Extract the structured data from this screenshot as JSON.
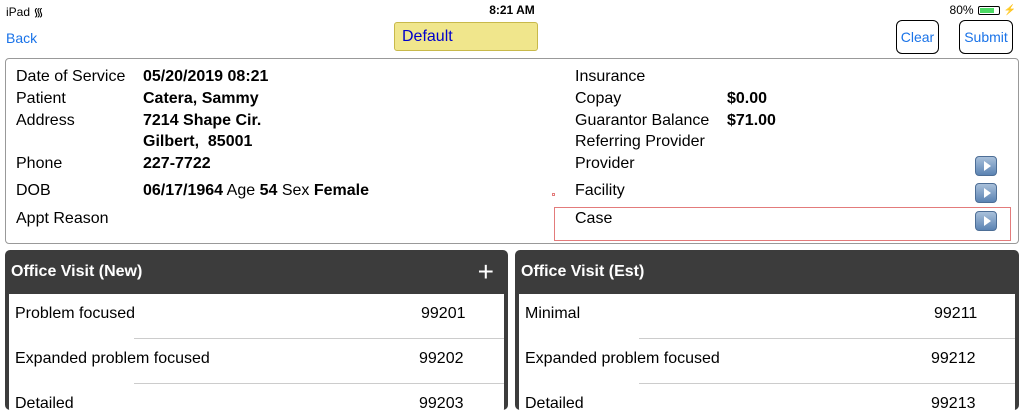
{
  "status": {
    "device": "iPad",
    "time": "8:21 AM",
    "battery": "80%"
  },
  "nav": {
    "back": "Back",
    "preset": "Default",
    "clear": "Clear",
    "submit": "Submit"
  },
  "patient": {
    "dos_label": "Date of Service",
    "dos": "05/20/2019 08:21",
    "patient_label": "Patient",
    "patient": "Catera, Sammy",
    "address_label": "Address",
    "address1": "7214 Shape Cir.",
    "address2": "Gilbert,  85001",
    "phone_label": "Phone",
    "phone": "227-7722",
    "dob_label": "DOB",
    "dob": "06/17/1964",
    "age_label": "Age",
    "age": "54",
    "sex_label": "Sex",
    "sex": "Female",
    "appt_label": "Appt Reason"
  },
  "billing": {
    "insurance_label": "Insurance",
    "copay_label": "Copay",
    "copay": "$0.00",
    "guarantor_label": "Guarantor Balance",
    "guarantor": "$71.00",
    "referring_label": "Referring Provider",
    "provider_label": "Provider",
    "facility_label": "Facility",
    "case_label": "Case"
  },
  "panels": [
    {
      "title": "Office Visit (New)",
      "plus": "+",
      "items": [
        {
          "name": "Problem focused",
          "code": "99201"
        },
        {
          "name": "Expanded problem focused",
          "code": "99202"
        },
        {
          "name": "Detailed",
          "code": "99203"
        }
      ]
    },
    {
      "title": "Office Visit (Est)",
      "items": [
        {
          "name": "Minimal",
          "code": "99211"
        },
        {
          "name": "Expanded problem focused",
          "code": "99212"
        },
        {
          "name": "Detailed",
          "code": "99213"
        }
      ]
    }
  ]
}
